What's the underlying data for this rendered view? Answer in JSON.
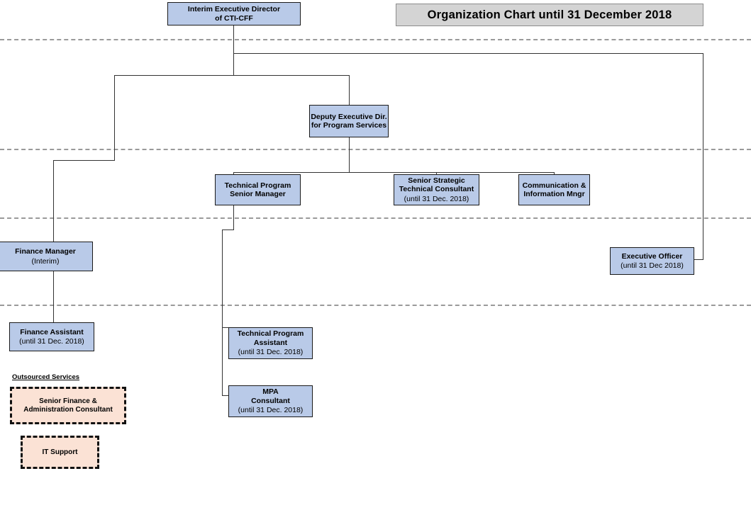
{
  "title_banner": {
    "text": "Organization Chart until 31 December 2018"
  },
  "outsourced": {
    "section_label": "Outsourced Services",
    "items": [
      {
        "title": "Senior Finance &\nAdministration Consultant"
      },
      {
        "title": "IT Support"
      }
    ]
  },
  "nodes": {
    "executive_director": {
      "title": "Interim Executive Director\nof CTI-CFF",
      "note": ""
    },
    "deputy_executive_director": {
      "title": "Deputy Executive Dir.\nfor Program Services",
      "note": ""
    },
    "technical_program_senior_manager": {
      "title": "Technical Program\nSenior Manager",
      "note": ""
    },
    "senior_strategic_technical_consultant": {
      "title": "Senior Strategic\nTechnical Consultant",
      "note": "(until 31 Dec. 2018)"
    },
    "communication_information_manager": {
      "title": "Communication &\nInformation Mngr",
      "note": ""
    },
    "finance_manager": {
      "title": "Finance Manager",
      "note": "(Interim)"
    },
    "executive_officer": {
      "title": "Executive  Officer",
      "note": "(until 31 Dec 2018)"
    },
    "finance_assistant": {
      "title": "Finance Assistant",
      "note": "(until 31 Dec. 2018)"
    },
    "technical_program_assistant": {
      "title": "Technical Program\nAssistant",
      "note": "(until 31 Dec. 2018)"
    },
    "mpa_consultant": {
      "title": "MPA\nConsultant",
      "note": "(until 31 Dec. 2018)"
    }
  },
  "colors": {
    "node_fill": "#b9cae8",
    "node_border": "#1a1a1a",
    "outsourced_fill": "#fbe2d5",
    "outsourced_border": "#111111",
    "banner_fill": "#d4d4d4",
    "separator": "#9a9a9a",
    "connector": "#333333",
    "page_background": "#ffffff"
  }
}
